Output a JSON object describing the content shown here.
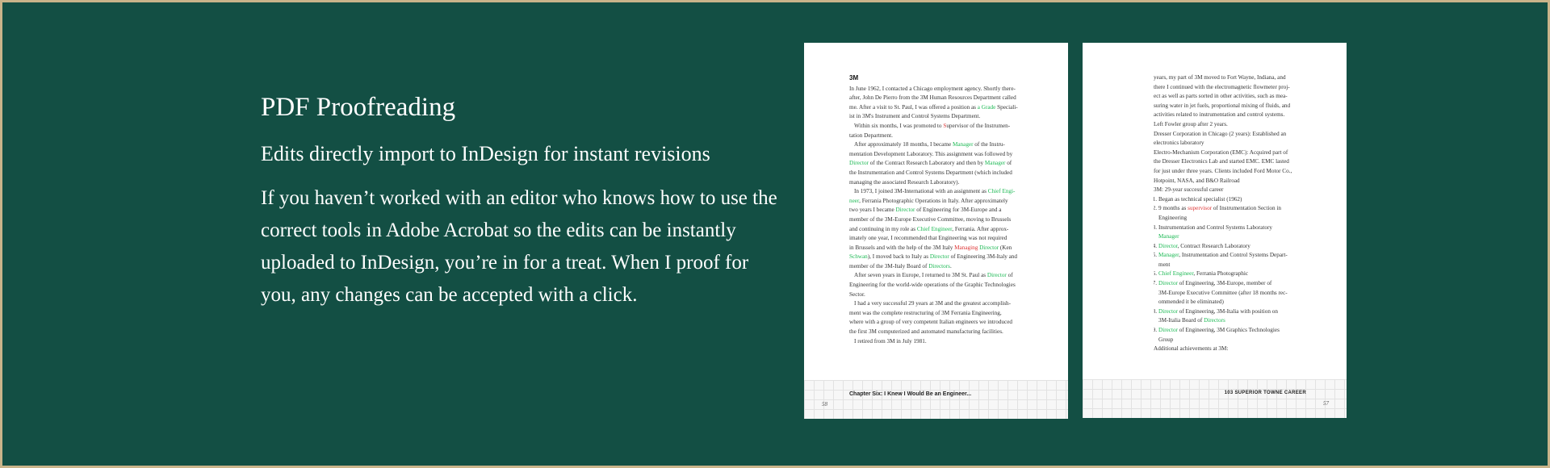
{
  "intro": {
    "heading": "PDF Proofreading",
    "subheading": "Edits directly import to InDesign for instant revisions",
    "body": "If you haven’t worked with an editor who knows how to use the correct tools in Adobe Acrobat so the edits can be instantly uploaded to InDesign, you’re in for a treat. When I proof for you, any changes can be accepted with a click."
  },
  "left_page": {
    "chapter_label": "3M",
    "footer_title": "Chapter Six: I Knew I Would Be an Engineer...",
    "page_number": "58"
  },
  "right_page": {
    "footer_title": "103 SUPERIOR TOWNE CAREER",
    "page_number": "57"
  },
  "colors": {
    "background": "#134f44",
    "border": "#c9b48a",
    "edit_green": "#1db954",
    "edit_red": "#d33333"
  }
}
